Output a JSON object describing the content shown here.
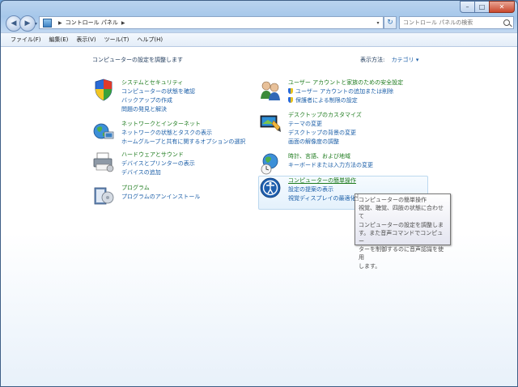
{
  "nav": {
    "address": "コントロール パネル",
    "search_placeholder": "コントロール パネルの検索"
  },
  "menu": [
    "ファイル(F)",
    "編集(E)",
    "表示(V)",
    "ツール(T)",
    "ヘルプ(H)"
  ],
  "content": {
    "title": "コンピューターの設定を調整します",
    "view_label": "表示方法:",
    "view_value": "カテゴリ ▾"
  },
  "categories": {
    "system": {
      "title": "システムとセキュリティ",
      "links": [
        "コンピューターの状態を確認",
        "バックアップの作成",
        "問題の発見と解決"
      ]
    },
    "network": {
      "title": "ネットワークとインターネット",
      "links": [
        "ネットワークの状態とタスクの表示",
        "ホームグループと共有に関するオプションの選択"
      ]
    },
    "hardware": {
      "title": "ハードウェアとサウンド",
      "links": [
        "デバイスとプリンターの表示",
        "デバイスの追加"
      ]
    },
    "programs": {
      "title": "プログラム",
      "links": [
        "プログラムのアンインストール"
      ]
    },
    "users": {
      "title": "ユーザー アカウントと家族のための安全設定",
      "links": [
        "ユーザー アカウントの追加または削除",
        "保護者による制限の設定"
      ]
    },
    "appearance": {
      "title": "デスクトップのカスタマイズ",
      "links": [
        "テーマの変更",
        "デスクトップの背景の変更",
        "画面の解像度の調整"
      ]
    },
    "clock": {
      "title": "時計、言語、および地域",
      "links": [
        "キーボードまたは入力方法の変更"
      ]
    },
    "ease": {
      "title": "コンピューターの簡単操作",
      "links": [
        "設定の提案の表示",
        "視覚ディスプレイの最適化"
      ]
    }
  },
  "tooltip": {
    "lines": [
      "コンピューターの簡単操作",
      "視覚、聴覚、四肢の状態に合わせて",
      "コンピューターの設定を調整しま",
      "す。また音声コマンドでコンピュー",
      "ターを制御するのに音声認識を使用",
      "します。"
    ]
  },
  "colors": {
    "category_title": "#1e7b1e",
    "link": "#1c5fa8",
    "window_chrome": "#a6c7ea"
  }
}
